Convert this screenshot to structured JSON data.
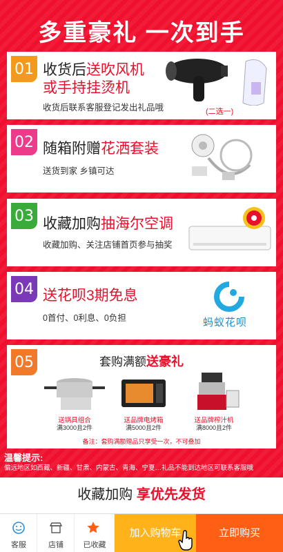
{
  "headline": "多重豪礼 一次到手",
  "cards": [
    {
      "number": "01",
      "title_plain": "收货后",
      "title_red": "送吹风机",
      "title_red_line2": "或手持挂烫机",
      "subtitle": "收货后联系客服登记发出礼品哦",
      "caption": "(二选一)",
      "badge_color": "#f39a1e"
    },
    {
      "number": "02",
      "title_plain": "随箱附赠",
      "title_red": "花洒套装",
      "subtitle": "送货到家 乡镇可达",
      "badge_color": "#ec3b8b"
    },
    {
      "number": "03",
      "title_plain": "收藏加购",
      "title_red": "抽海尔空调",
      "subtitle": "收藏加购、关注店铺首页参与抽奖",
      "badge_color": "#3aab3a"
    },
    {
      "number": "04",
      "title_red": "送花呗3期免息",
      "subtitle": "0首付、0利息、0负担",
      "logo_text": "蚂蚁花呗",
      "badge_color": "#7a3ab8"
    },
    {
      "number": "05",
      "title_plain": "套购满额",
      "title_red": "送豪礼",
      "badge_color": "#f07a2a",
      "products": [
        {
          "name": "送锅具组合",
          "condition": "满3000且2件"
        },
        {
          "name": "送品牌电烤箱",
          "condition": "满5000且2件"
        },
        {
          "name": "送品牌榨汁机",
          "condition": "满8000且2件"
        }
      ],
      "note": "备注：套购满额赠品只享受一次，不可叠加"
    }
  ],
  "tips": {
    "label": "温馨提示:",
    "text": "偏远地区如西藏、新疆、甘肃、内蒙古、青海、宁夏…礼品不能到达地区可联系客服哦"
  },
  "collect": {
    "plain": "收藏加购",
    "red": "享优先发货"
  },
  "bottom_nav": {
    "service": "客服",
    "store": "店铺",
    "favorited": "已收藏",
    "add_to_cart": "加入购物车",
    "buy_now": "立即购买"
  },
  "colors": {
    "brand_red": "#e8102a",
    "cart_yellow": "#ffb21a",
    "buy_orange": "#ff5f14"
  }
}
